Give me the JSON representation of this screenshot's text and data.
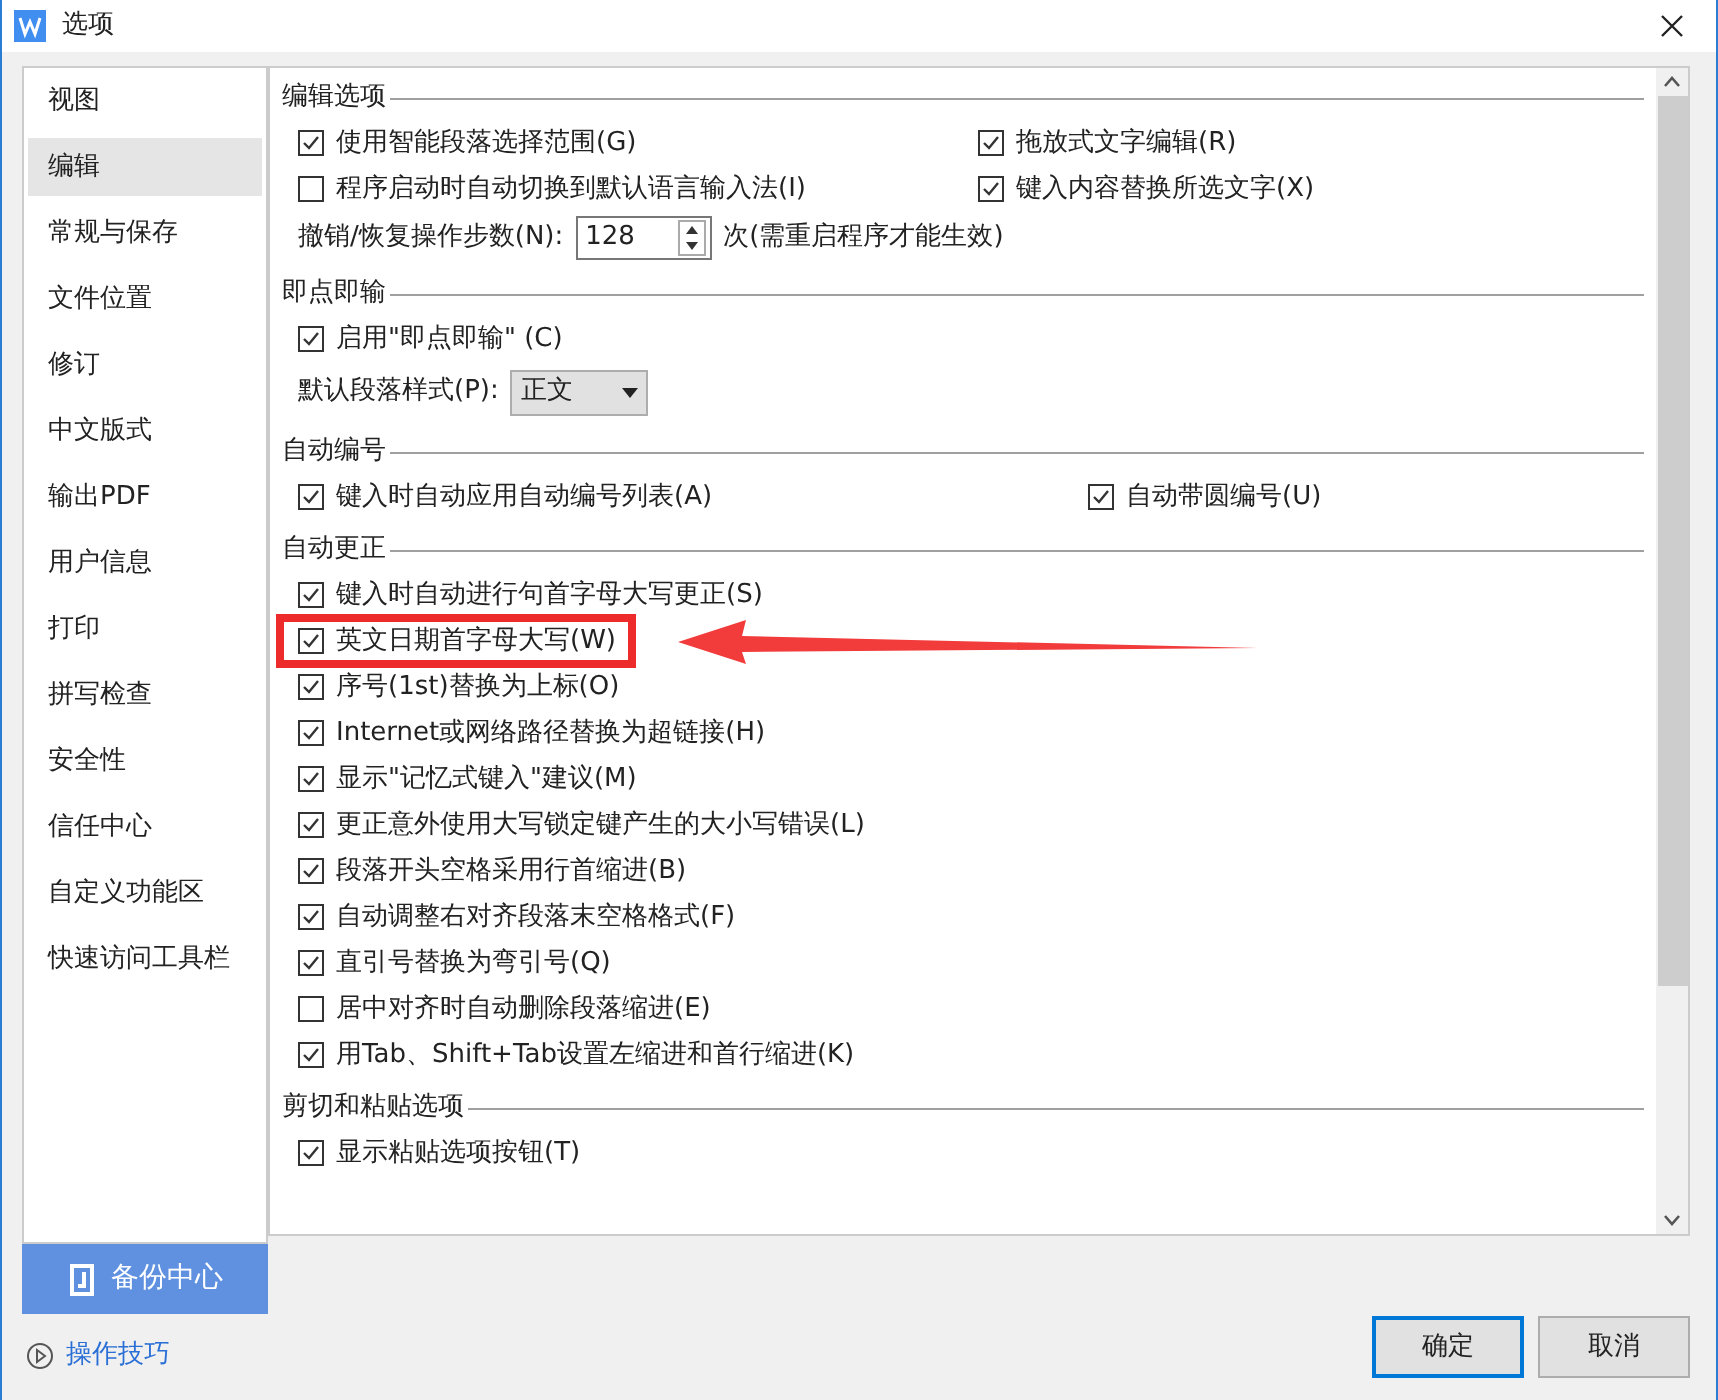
{
  "window": {
    "title": "选项"
  },
  "sidebar": {
    "items": [
      {
        "label": "视图",
        "selected": false
      },
      {
        "label": "编辑",
        "selected": true
      },
      {
        "label": "常规与保存",
        "selected": false
      },
      {
        "label": "文件位置",
        "selected": false
      },
      {
        "label": "修订",
        "selected": false
      },
      {
        "label": "中文版式",
        "selected": false
      },
      {
        "label": "输出PDF",
        "selected": false
      },
      {
        "label": "用户信息",
        "selected": false
      },
      {
        "label": "打印",
        "selected": false
      },
      {
        "label": "拼写检查",
        "selected": false
      },
      {
        "label": "安全性",
        "selected": false
      },
      {
        "label": "信任中心",
        "selected": false
      },
      {
        "label": "自定义功能区",
        "selected": false
      },
      {
        "label": "快速访问工具栏",
        "selected": false
      }
    ],
    "backup_button": "备份中心",
    "tips_link": "操作技巧"
  },
  "sections": [
    {
      "title": "编辑选项",
      "rows": [
        [
          {
            "kind": "checkbox",
            "label": "使用智能段落选择范围(G)",
            "checked": true
          },
          {
            "kind": "checkbox",
            "label": "拖放式文字编辑(R)",
            "checked": true
          }
        ],
        [
          {
            "kind": "checkbox",
            "label": "程序启动时自动切换到默认语言输入法(I)",
            "checked": false
          },
          {
            "kind": "checkbox",
            "label": "键入内容替换所选文字(X)",
            "checked": true
          }
        ],
        [
          {
            "kind": "spinner",
            "label": "撤销/恢复操作步数(N):",
            "value": "128",
            "suffix": "次(需重启程序才能生效)"
          }
        ]
      ]
    },
    {
      "title": "即点即输",
      "rows": [
        [
          {
            "kind": "checkbox",
            "label": "启用\"即点即输\" (C)",
            "checked": true
          }
        ],
        [
          {
            "kind": "dropdown",
            "label": "默认段落样式(P):",
            "value": "正文"
          }
        ]
      ]
    },
    {
      "title": "自动编号",
      "rows": [
        [
          {
            "kind": "checkbox",
            "label": "键入时自动应用自动编号列表(A)",
            "checked": true
          },
          {
            "kind": "checkbox",
            "label": "自动带圆编号(U)",
            "checked": true
          }
        ]
      ]
    },
    {
      "title": "自动更正",
      "rows": [
        [
          {
            "kind": "checkbox",
            "label": "键入时自动进行句首字母大写更正(S)",
            "checked": true
          }
        ],
        [
          {
            "kind": "checkbox",
            "label": "英文日期首字母大写(W)",
            "checked": true,
            "highlighted": true
          }
        ],
        [
          {
            "kind": "checkbox",
            "label": "序号(1st)替换为上标(O)",
            "checked": true
          }
        ],
        [
          {
            "kind": "checkbox",
            "label": "Internet或网络路径替换为超链接(H)",
            "checked": true
          }
        ],
        [
          {
            "kind": "checkbox",
            "label": "显示\"记忆式键入\"建议(M)",
            "checked": true
          }
        ],
        [
          {
            "kind": "checkbox",
            "label": "更正意外使用大写锁定键产生的大小写错误(L)",
            "checked": true
          }
        ],
        [
          {
            "kind": "checkbox",
            "label": "段落开头空格采用行首缩进(B)",
            "checked": true
          }
        ],
        [
          {
            "kind": "checkbox",
            "label": "自动调整右对齐段落末空格格式(F)",
            "checked": true
          }
        ],
        [
          {
            "kind": "checkbox",
            "label": "直引号替换为弯引号(Q)",
            "checked": true
          }
        ],
        [
          {
            "kind": "checkbox",
            "label": "居中对齐时自动删除段落缩进(E)",
            "checked": false
          }
        ],
        [
          {
            "kind": "checkbox",
            "label": "用Tab、Shift+Tab设置左缩进和首行缩进(K)",
            "checked": true
          }
        ]
      ]
    },
    {
      "title": "剪切和粘贴选项",
      "rows": [
        [
          {
            "kind": "checkbox",
            "label": "显示粘贴选项按钮(T)",
            "checked": true
          }
        ]
      ]
    }
  ],
  "buttons": [
    {
      "label": "确定",
      "selected": true
    },
    {
      "label": "取消",
      "selected": false
    }
  ]
}
